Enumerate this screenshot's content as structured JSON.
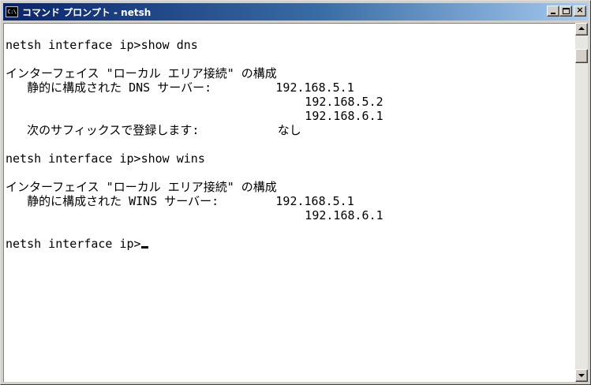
{
  "window": {
    "title": "コマンド プロンプト - netsh",
    "icon_text": "C:\\",
    "buttons": {
      "minimize_icon": "minimize-icon",
      "maximize_icon": "maximize-icon",
      "close_icon": "close-icon",
      "close_glyph": "×"
    }
  },
  "console": {
    "lines": [
      "netsh interface ip>show dns",
      "",
      "インターフェイス \"ローカル エリア接続\" の構成",
      "   静的に構成された DNS サーバー:         192.168.5.1",
      "                                          192.168.5.2",
      "                                          192.168.6.1",
      "   次のサフィックスで登録します:           なし",
      "",
      "netsh interface ip>show wins",
      "",
      "インターフェイス \"ローカル エリア接続\" の構成",
      "   静的に構成された WINS サーバー:        192.168.5.1",
      "                                          192.168.6.1",
      ""
    ],
    "prompt": "netsh interface ip>"
  },
  "colors": {
    "titlebar_start": "#0a246a",
    "titlebar_end": "#a6caf0",
    "console_bg": "#ffffff",
    "console_text": "#000000",
    "chrome": "#d4d0c8"
  }
}
